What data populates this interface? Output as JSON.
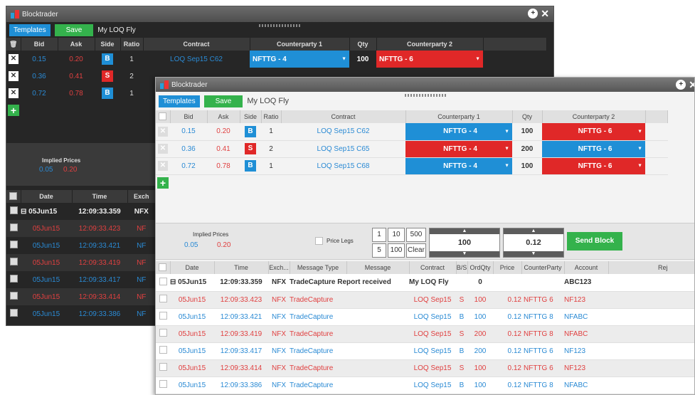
{
  "app_title": "Blocktrader",
  "toolbar": {
    "templates_label": "Templates",
    "save_label": "Save",
    "template_name": "My LOQ Fly"
  },
  "legs_header": [
    "Bid",
    "Ask",
    "Side",
    "Ratio",
    "Contract",
    "Counterparty 1",
    "Qty",
    "Counterparty 2"
  ],
  "legs": [
    {
      "bid": "0.15",
      "ask": "0.20",
      "side": "B",
      "ratio": "1",
      "contract": "LOQ Sep15 C62",
      "cp1": "NFTTG - 4",
      "cp1_color": "#1f8fd6",
      "qty": "100",
      "cp2": "NFTTG - 6",
      "cp2_color": "#e02828"
    },
    {
      "bid": "0.36",
      "ask": "0.41",
      "side": "S",
      "ratio": "2",
      "contract": "LOQ Sep15 C65",
      "cp1": "NFTTG - 4",
      "cp1_color": "#e02828",
      "qty": "200",
      "cp2": "NFTTG - 6",
      "cp2_color": "#1f8fd6"
    },
    {
      "bid": "0.72",
      "ask": "0.78",
      "side": "B",
      "ratio": "1",
      "contract": "LOQ Sep15 C68",
      "cp1": "NFTTG - 4",
      "cp1_color": "#1f8fd6",
      "qty": "100",
      "cp2": "NFTTG - 6",
      "cp2_color": "#e02828"
    }
  ],
  "implied": {
    "label": "Implied Prices",
    "bid": "0.05",
    "ask": "0.20"
  },
  "price_legs_label": "Price Legs",
  "qty_buttons": [
    "1",
    "10",
    "500",
    "5",
    "100",
    "Clear"
  ],
  "qty_stepper_value": "100",
  "price_stepper_value": "0.12",
  "send_block_label": "Send Block",
  "log_header": [
    "Date",
    "Time",
    "Exch...",
    "Message Type",
    "Message",
    "Contract",
    "B/S",
    "OrdQty",
    "Price",
    "CounterParty",
    "Account",
    "Rej"
  ],
  "dark_log_header": [
    "Date",
    "Time",
    "Exch"
  ],
  "log_group": {
    "date": "05Jun15",
    "time": "12:09:33.359",
    "exch": "NFX",
    "message": "TradeCapture Report received",
    "contract": "My LOQ Fly",
    "qty": "0",
    "account": "ABC123"
  },
  "log_rows": [
    {
      "date": "05Jun15",
      "time": "12:09:33.423",
      "exch": "NFX",
      "type": "TradeCapture",
      "contract": "LOQ Sep15",
      "bs": "S",
      "qty": "100",
      "price": "0.12",
      "cp": "NFTTG 6",
      "account": "NF123",
      "color": "#e04040"
    },
    {
      "date": "05Jun15",
      "time": "12:09:33.421",
      "exch": "NFX",
      "type": "TradeCapture",
      "contract": "LOQ Sep15",
      "bs": "B",
      "qty": "100",
      "price": "0.12",
      "cp": "NFTTG 8",
      "account": "NFABC",
      "color": "#2a8ad4"
    },
    {
      "date": "05Jun15",
      "time": "12:09:33.419",
      "exch": "NFX",
      "type": "TradeCapture",
      "contract": "LOQ Sep15",
      "bs": "S",
      "qty": "200",
      "price": "0.12",
      "cp": "NFTTG 8",
      "account": "NFABC",
      "color": "#e04040"
    },
    {
      "date": "05Jun15",
      "time": "12:09:33.417",
      "exch": "NFX",
      "type": "TradeCapture",
      "contract": "LOQ Sep15",
      "bs": "B",
      "qty": "200",
      "price": "0.12",
      "cp": "NFTTG 6",
      "account": "NF123",
      "color": "#2a8ad4"
    },
    {
      "date": "05Jun15",
      "time": "12:09:33.414",
      "exch": "NFX",
      "type": "TradeCapture",
      "contract": "LOQ Sep15",
      "bs": "S",
      "qty": "100",
      "price": "0.12",
      "cp": "NFTTG 6",
      "account": "NF123",
      "color": "#e04040"
    },
    {
      "date": "05Jun15",
      "time": "12:09:33.386",
      "exch": "NFX",
      "type": "TradeCapture",
      "contract": "LOQ Sep15",
      "bs": "B",
      "qty": "100",
      "price": "0.12",
      "cp": "NFTTG 8",
      "account": "NFABC",
      "color": "#2a8ad4"
    }
  ],
  "dark_log_rows": [
    {
      "date": "05Jun15",
      "time": "12:09:33.423",
      "exch": "NF",
      "color": "#e04040"
    },
    {
      "date": "05Jun15",
      "time": "12:09:33.421",
      "exch": "NF",
      "color": "#2a8ad4"
    },
    {
      "date": "05Jun15",
      "time": "12:09:33.419",
      "exch": "NF",
      "color": "#e04040"
    },
    {
      "date": "05Jun15",
      "time": "12:09:33.417",
      "exch": "NF",
      "color": "#2a8ad4"
    },
    {
      "date": "05Jun15",
      "time": "12:09:33.414",
      "exch": "NF",
      "color": "#e04040"
    },
    {
      "date": "05Jun15",
      "time": "12:09:33.386",
      "exch": "NF",
      "color": "#2a8ad4"
    }
  ]
}
